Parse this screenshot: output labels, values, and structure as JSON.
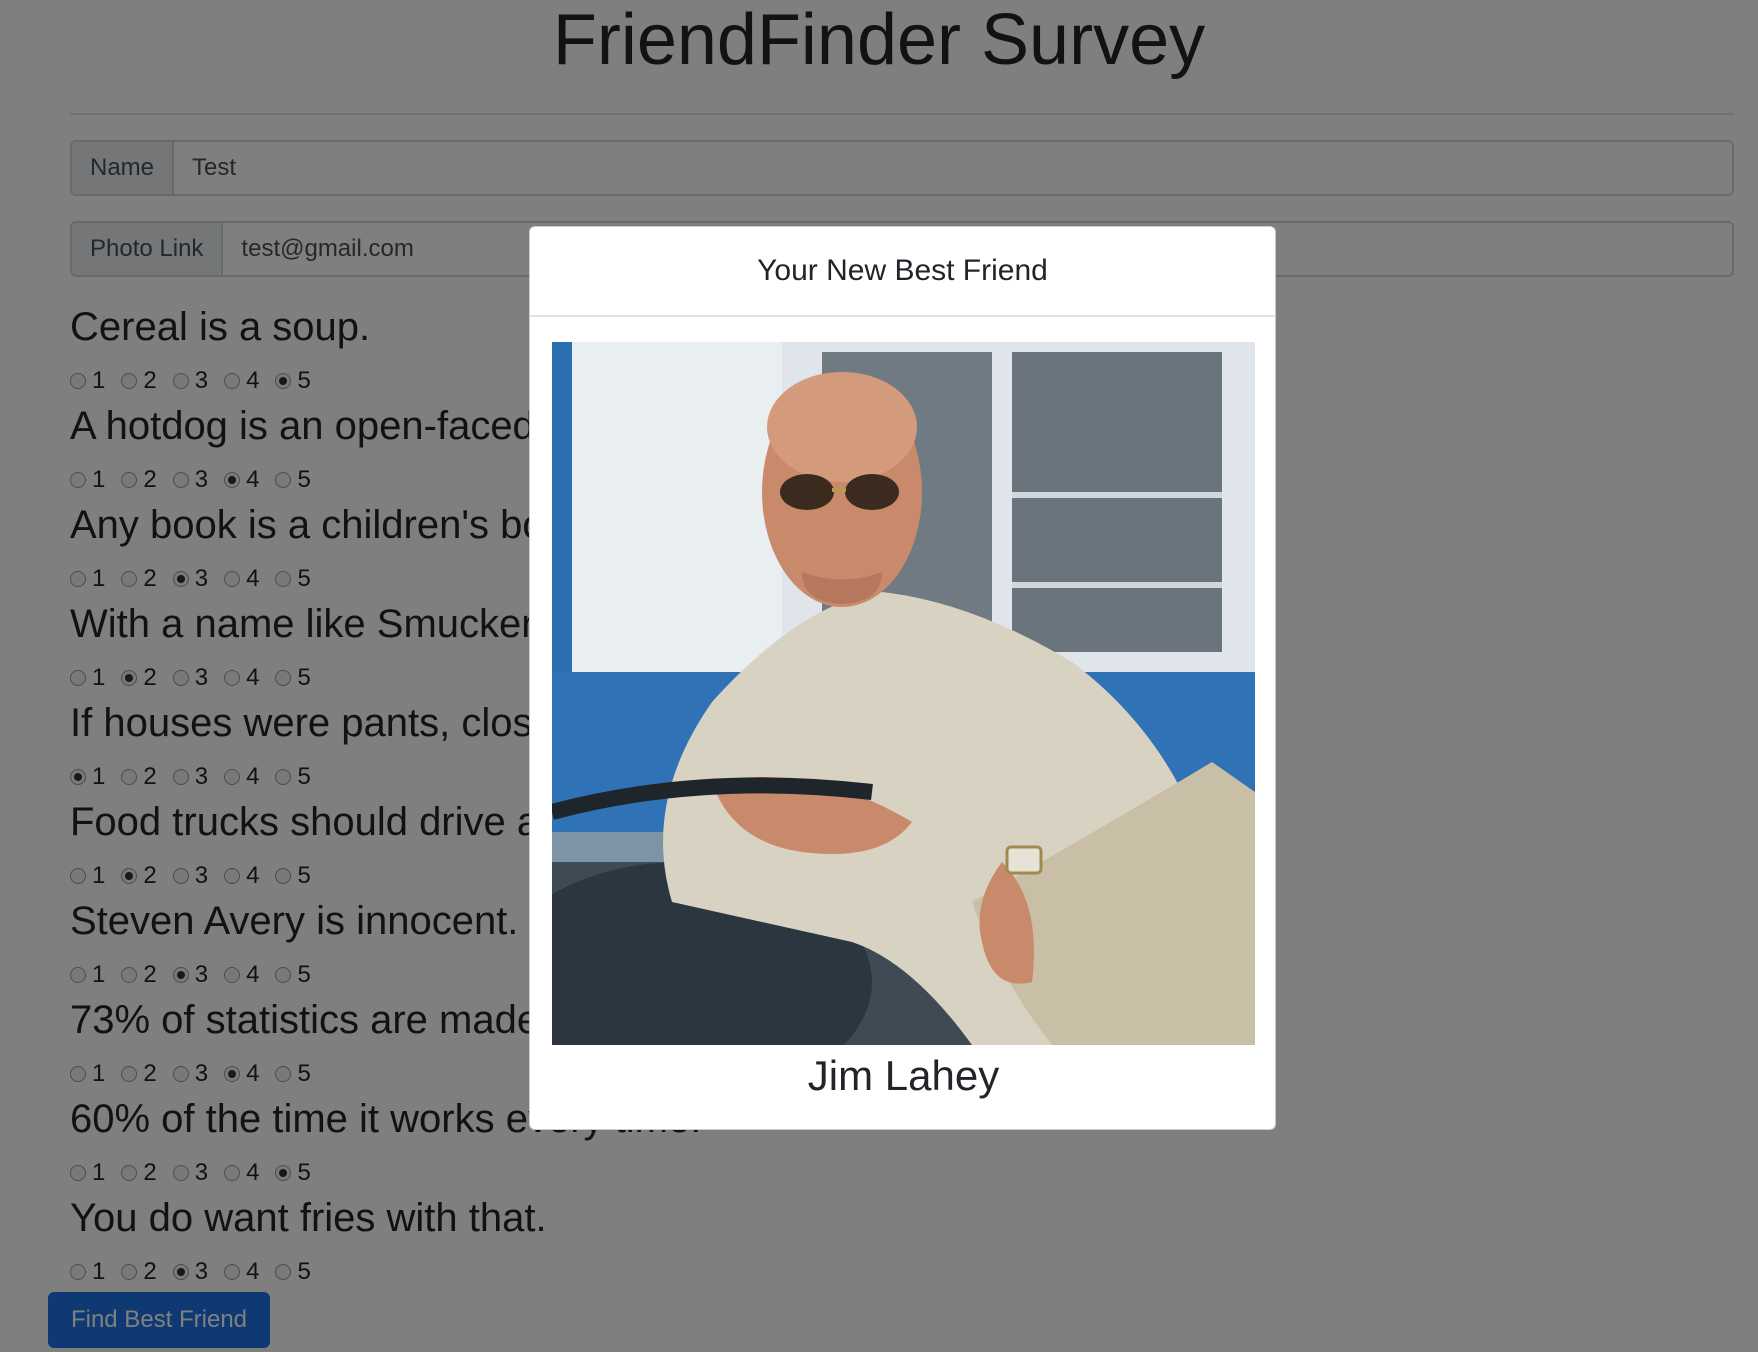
{
  "header": {
    "title": "FriendFinder Survey"
  },
  "form": {
    "name": {
      "label": "Name",
      "value": "Test"
    },
    "photo": {
      "label": "Photo Link",
      "value": "test@gmail.com"
    }
  },
  "questions": [
    {
      "text": "Cereal is a soup.",
      "selected": 5
    },
    {
      "text": "A hotdog is an open-faced sandwich.",
      "selected": 4
    },
    {
      "text": "Any book is a children's book if you read it to a child.",
      "selected": 3
    },
    {
      "text": "With a name like Smucker's, it has to be good.",
      "selected": 2
    },
    {
      "text": "If houses were pants, closets would be pockets.",
      "selected": 1
    },
    {
      "text": "Food trucks should drive around like ice cream trucks do.",
      "selected": 2
    },
    {
      "text": "Steven Avery is innocent.",
      "selected": 3
    },
    {
      "text": "73% of statistics are made up on the spot.",
      "selected": 4
    },
    {
      "text": "60% of the time it works every time.",
      "selected": 5
    },
    {
      "text": "You do want fries with that.",
      "selected": 3
    }
  ],
  "options": [
    "1",
    "2",
    "3",
    "4",
    "5"
  ],
  "submit_label": "Find Best Friend",
  "modal": {
    "title": "Your New Best Friend",
    "friend_name": "Jim Lahey",
    "photo": "photo-of-man-with-aviator-sunglasses-on-tractor"
  },
  "colors": {
    "primary": "#1d72e6",
    "backdrop": "rgba(0,0,0,0.5)"
  }
}
